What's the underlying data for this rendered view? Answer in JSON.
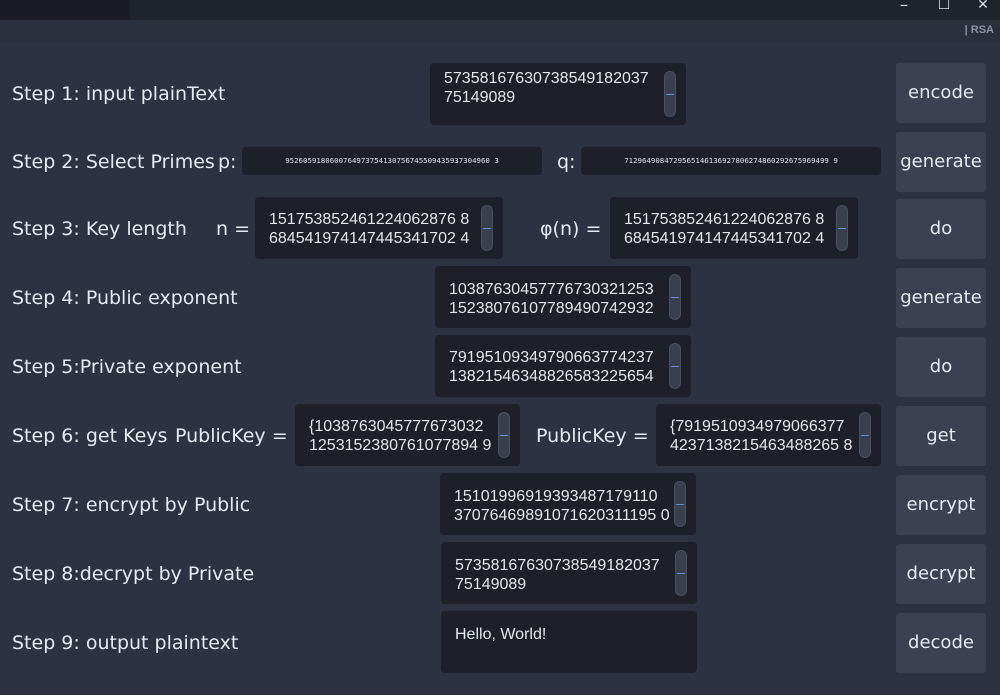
{
  "window": {
    "minimize_glyph": "–",
    "maximize_glyph": "☐",
    "close_glyph": "✕",
    "tag": "| RSA"
  },
  "steps": {
    "s1": {
      "label": "Step 1: input plainText",
      "value": "57358167630738549182037\n75149089",
      "button": "encode"
    },
    "s2": {
      "label": "Step 2: Select Primes",
      "p_label": "p:",
      "p_value": "9526059180600764973754130756745509435937304960 3",
      "q_label": "q:",
      "q_value": "7129649084729565146136927806274860292675969499 9",
      "button": "generate"
    },
    "s3": {
      "label": "Step 3: Key length",
      "n_label": "n =",
      "n_value": "151753852461224062876 8\n684541974147445341702 4",
      "phi_label": "φ(n) =",
      "phi_value": "151753852461224062876 8\n684541974147445341702 4",
      "button": "do"
    },
    "s4": {
      "label": "Step 4: Public exponent",
      "value": "10387630457776730321253\n15238076107789490742932",
      "button": "generate"
    },
    "s5": {
      "label": "Step 5:Private exponent",
      "value": "79195109349790663774237\n13821546348826583225654",
      "button": "do"
    },
    "s6": {
      "label": "Step 6: get Keys",
      "pub_label": "PublicKey =",
      "pub_value": "{1038763045777673032\n1253152380761077894 9",
      "priv_label": "PublicKey =",
      "priv_value": "{7919510934979066377\n4237138215463488265 8",
      "button": "get"
    },
    "s7": {
      "label": "Step 7: encrypt by Public",
      "value": "15101996919393487179110\n37076469891071620311195 0",
      "button": "encrypt"
    },
    "s8": {
      "label": "Step 8:decrypt by Private",
      "value": "57358167630738549182037\n75149089",
      "button": "decrypt"
    },
    "s9": {
      "label": "Step 9: output plaintext",
      "value": "Hello, World!",
      "button": "decode"
    }
  }
}
